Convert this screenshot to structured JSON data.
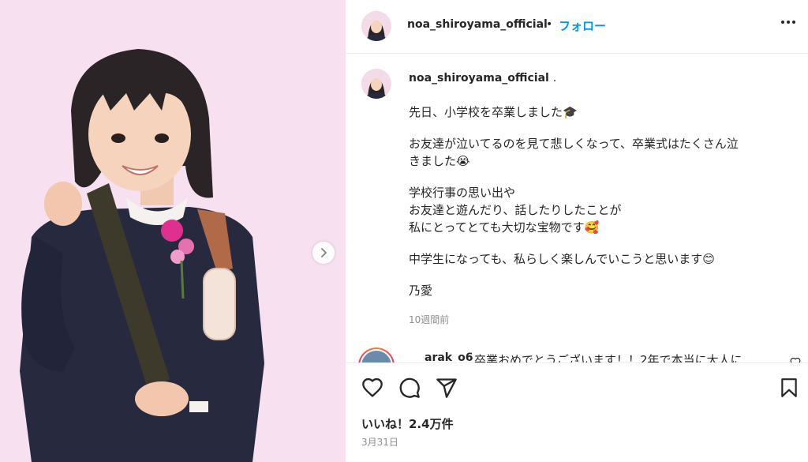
{
  "media": {
    "next_icon": "chevron-right-icon"
  },
  "header": {
    "username": "noa_shiroyama_official",
    "separator": "•",
    "follow_label": "フォロー",
    "more_icon": "more-horizontal-icon"
  },
  "caption": {
    "username": "noa_shiroyama_official",
    "username_suffix": ".",
    "paragraphs": [
      [
        "先日、小学校を卒業しました🎓"
      ],
      [
        "お友達が泣いてるのを見て悲しくなって、卒業式はたくさん泣",
        "きました😭"
      ],
      [
        "学校行事の思い出や",
        "お友達と遊んだり、話したりしたことが",
        "私にとってとても大切な宝物です🥰"
      ],
      [
        "中学生になっても、私らしく楽しんでいこうと思います😊"
      ],
      [
        "乃愛"
      ]
    ],
    "time": "10週間前"
  },
  "comment": {
    "username": "arak_o6",
    "text": "卒業おめでとうございます！！2年で本当に大人に"
  },
  "actions": {
    "like_icon": "heart-icon",
    "comment_icon": "comment-icon",
    "share_icon": "send-icon",
    "save_icon": "bookmark-icon",
    "likes": "いいね！2.4万件",
    "date": "3月31日"
  },
  "colors": {
    "accent": "#0095f6",
    "media_bg": "#f7e0ef",
    "text": "#262626",
    "muted": "#8e8e8e"
  }
}
